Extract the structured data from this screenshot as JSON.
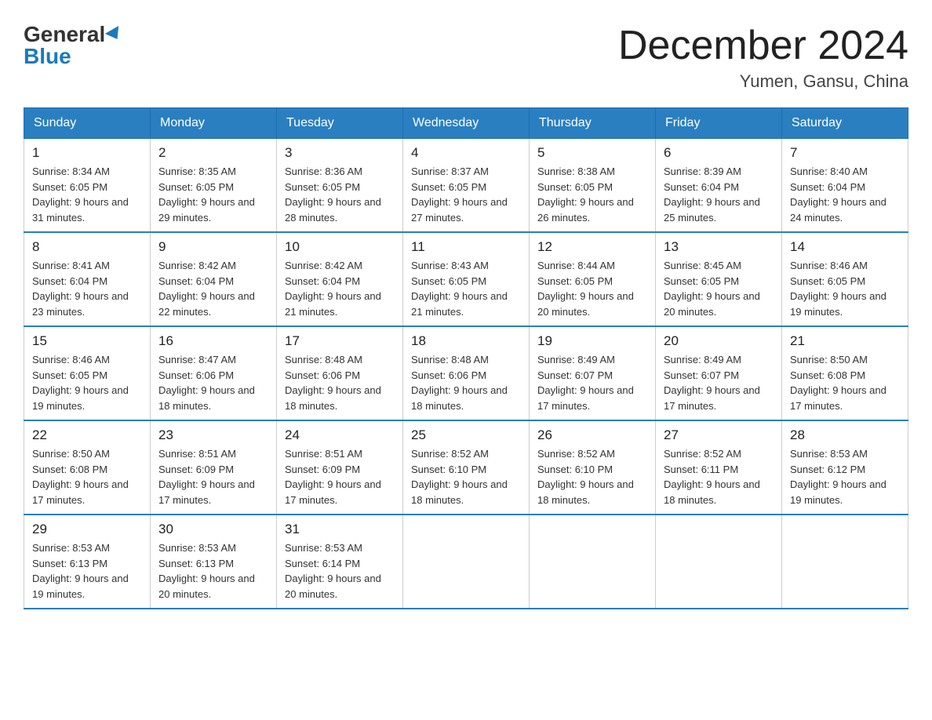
{
  "header": {
    "logo_general": "General",
    "logo_blue": "Blue",
    "month_title": "December 2024",
    "location": "Yumen, Gansu, China"
  },
  "columns": [
    "Sunday",
    "Monday",
    "Tuesday",
    "Wednesday",
    "Thursday",
    "Friday",
    "Saturday"
  ],
  "weeks": [
    [
      {
        "day": "1",
        "sunrise": "8:34 AM",
        "sunset": "6:05 PM",
        "daylight": "9 hours and 31 minutes."
      },
      {
        "day": "2",
        "sunrise": "8:35 AM",
        "sunset": "6:05 PM",
        "daylight": "9 hours and 29 minutes."
      },
      {
        "day": "3",
        "sunrise": "8:36 AM",
        "sunset": "6:05 PM",
        "daylight": "9 hours and 28 minutes."
      },
      {
        "day": "4",
        "sunrise": "8:37 AM",
        "sunset": "6:05 PM",
        "daylight": "9 hours and 27 minutes."
      },
      {
        "day": "5",
        "sunrise": "8:38 AM",
        "sunset": "6:05 PM",
        "daylight": "9 hours and 26 minutes."
      },
      {
        "day": "6",
        "sunrise": "8:39 AM",
        "sunset": "6:04 PM",
        "daylight": "9 hours and 25 minutes."
      },
      {
        "day": "7",
        "sunrise": "8:40 AM",
        "sunset": "6:04 PM",
        "daylight": "9 hours and 24 minutes."
      }
    ],
    [
      {
        "day": "8",
        "sunrise": "8:41 AM",
        "sunset": "6:04 PM",
        "daylight": "9 hours and 23 minutes."
      },
      {
        "day": "9",
        "sunrise": "8:42 AM",
        "sunset": "6:04 PM",
        "daylight": "9 hours and 22 minutes."
      },
      {
        "day": "10",
        "sunrise": "8:42 AM",
        "sunset": "6:04 PM",
        "daylight": "9 hours and 21 minutes."
      },
      {
        "day": "11",
        "sunrise": "8:43 AM",
        "sunset": "6:05 PM",
        "daylight": "9 hours and 21 minutes."
      },
      {
        "day": "12",
        "sunrise": "8:44 AM",
        "sunset": "6:05 PM",
        "daylight": "9 hours and 20 minutes."
      },
      {
        "day": "13",
        "sunrise": "8:45 AM",
        "sunset": "6:05 PM",
        "daylight": "9 hours and 20 minutes."
      },
      {
        "day": "14",
        "sunrise": "8:46 AM",
        "sunset": "6:05 PM",
        "daylight": "9 hours and 19 minutes."
      }
    ],
    [
      {
        "day": "15",
        "sunrise": "8:46 AM",
        "sunset": "6:05 PM",
        "daylight": "9 hours and 19 minutes."
      },
      {
        "day": "16",
        "sunrise": "8:47 AM",
        "sunset": "6:06 PM",
        "daylight": "9 hours and 18 minutes."
      },
      {
        "day": "17",
        "sunrise": "8:48 AM",
        "sunset": "6:06 PM",
        "daylight": "9 hours and 18 minutes."
      },
      {
        "day": "18",
        "sunrise": "8:48 AM",
        "sunset": "6:06 PM",
        "daylight": "9 hours and 18 minutes."
      },
      {
        "day": "19",
        "sunrise": "8:49 AM",
        "sunset": "6:07 PM",
        "daylight": "9 hours and 17 minutes."
      },
      {
        "day": "20",
        "sunrise": "8:49 AM",
        "sunset": "6:07 PM",
        "daylight": "9 hours and 17 minutes."
      },
      {
        "day": "21",
        "sunrise": "8:50 AM",
        "sunset": "6:08 PM",
        "daylight": "9 hours and 17 minutes."
      }
    ],
    [
      {
        "day": "22",
        "sunrise": "8:50 AM",
        "sunset": "6:08 PM",
        "daylight": "9 hours and 17 minutes."
      },
      {
        "day": "23",
        "sunrise": "8:51 AM",
        "sunset": "6:09 PM",
        "daylight": "9 hours and 17 minutes."
      },
      {
        "day": "24",
        "sunrise": "8:51 AM",
        "sunset": "6:09 PM",
        "daylight": "9 hours and 17 minutes."
      },
      {
        "day": "25",
        "sunrise": "8:52 AM",
        "sunset": "6:10 PM",
        "daylight": "9 hours and 18 minutes."
      },
      {
        "day": "26",
        "sunrise": "8:52 AM",
        "sunset": "6:10 PM",
        "daylight": "9 hours and 18 minutes."
      },
      {
        "day": "27",
        "sunrise": "8:52 AM",
        "sunset": "6:11 PM",
        "daylight": "9 hours and 18 minutes."
      },
      {
        "day": "28",
        "sunrise": "8:53 AM",
        "sunset": "6:12 PM",
        "daylight": "9 hours and 19 minutes."
      }
    ],
    [
      {
        "day": "29",
        "sunrise": "8:53 AM",
        "sunset": "6:13 PM",
        "daylight": "9 hours and 19 minutes."
      },
      {
        "day": "30",
        "sunrise": "8:53 AM",
        "sunset": "6:13 PM",
        "daylight": "9 hours and 20 minutes."
      },
      {
        "day": "31",
        "sunrise": "8:53 AM",
        "sunset": "6:14 PM",
        "daylight": "9 hours and 20 minutes."
      },
      null,
      null,
      null,
      null
    ]
  ]
}
